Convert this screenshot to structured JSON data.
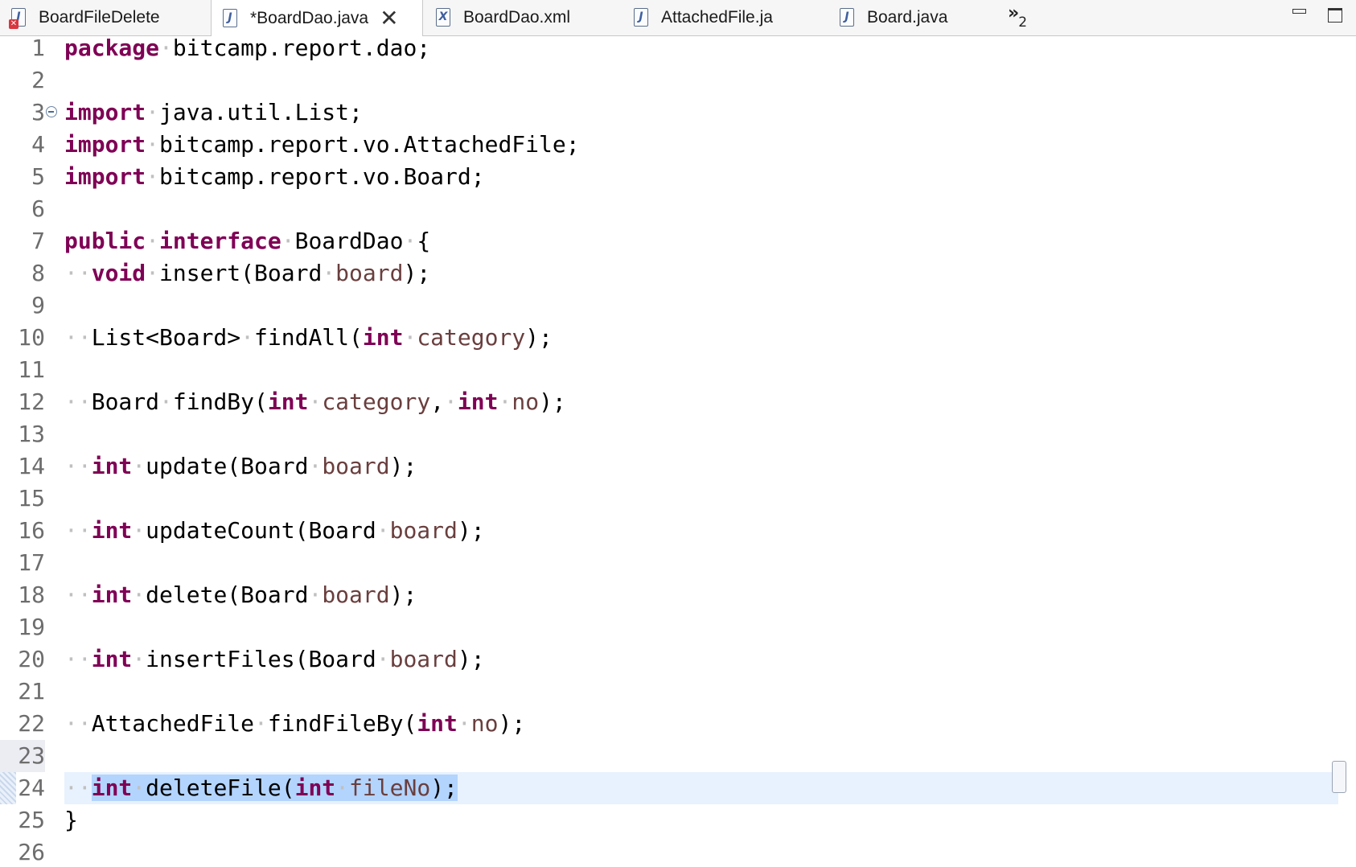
{
  "tabs": [
    {
      "label": "BoardFileDelete",
      "icon": "java-file-error-icon",
      "glyph": "J",
      "active": false,
      "closable": false
    },
    {
      "label": "*BoardDao.java",
      "icon": "java-file-icon",
      "glyph": "J",
      "active": true,
      "closable": true
    },
    {
      "label": "BoardDao.xml",
      "icon": "xml-file-icon",
      "glyph": "X",
      "active": false,
      "closable": false
    },
    {
      "label": "AttachedFile.ja",
      "icon": "java-file-icon",
      "glyph": "J",
      "active": false,
      "closable": false
    },
    {
      "label": "Board.java",
      "icon": "java-file-icon",
      "glyph": "J",
      "active": false,
      "closable": false
    }
  ],
  "tab_close_glyph": "✕",
  "overflow": {
    "chevron": "»",
    "count": "2"
  },
  "editor": {
    "current_line": 24,
    "lines": [
      {
        "n": "1",
        "code": "package·bitcamp.report.dao;"
      },
      {
        "n": "2",
        "code": ""
      },
      {
        "n": "3",
        "code": "import·java.util.List;",
        "fold": true
      },
      {
        "n": "4",
        "code": "import·bitcamp.report.vo.AttachedFile;"
      },
      {
        "n": "5",
        "code": "import·bitcamp.report.vo.Board;"
      },
      {
        "n": "6",
        "code": ""
      },
      {
        "n": "7",
        "code": "public·interface·BoardDao·{"
      },
      {
        "n": "8",
        "code": "··void·insert(Board·board);"
      },
      {
        "n": "9",
        "code": ""
      },
      {
        "n": "10",
        "code": "··List<Board>·findAll(int·category);"
      },
      {
        "n": "11",
        "code": ""
      },
      {
        "n": "12",
        "code": "··Board·findBy(int·category,·int·no);"
      },
      {
        "n": "13",
        "code": ""
      },
      {
        "n": "14",
        "code": "··int·update(Board·board);"
      },
      {
        "n": "15",
        "code": ""
      },
      {
        "n": "16",
        "code": "··int·updateCount(Board·board);"
      },
      {
        "n": "17",
        "code": ""
      },
      {
        "n": "18",
        "code": "··int·delete(Board·board);"
      },
      {
        "n": "19",
        "code": ""
      },
      {
        "n": "20",
        "code": "··int·insertFiles(Board·board);"
      },
      {
        "n": "21",
        "code": ""
      },
      {
        "n": "22",
        "code": "··AttachedFile·findFileBy(int·no);"
      },
      {
        "n": "23",
        "code": ""
      },
      {
        "n": "24",
        "code": "··int·deleteFile(int·fileNo);"
      },
      {
        "n": "25",
        "code": "}"
      },
      {
        "n": "26",
        "code": ""
      }
    ]
  },
  "syntax": {
    "keywords": [
      "package",
      "import",
      "public",
      "interface",
      "void",
      "int"
    ],
    "params": [
      "board",
      "category",
      "no",
      "fileNo"
    ]
  },
  "colors": {
    "keyword": "#7f0055",
    "param": "#6a3e3e",
    "whitespace": "#c0c0c0",
    "selection": "#b3d4fd",
    "current_line": "#e8f2fe"
  }
}
